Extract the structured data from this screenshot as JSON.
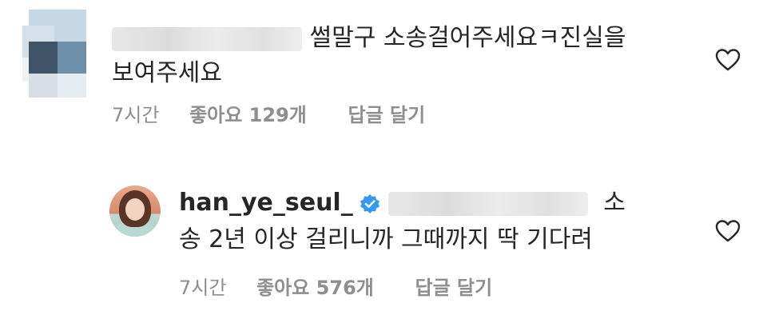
{
  "comments": [
    {
      "text_line1": "썰말구 소송걸어주세요ㅋ진실을",
      "text_line2": "보여주세요",
      "time": "7시간",
      "likes": "좋아요 129개",
      "reply": "답글 달기",
      "like_icon": "heart-outline-icon"
    },
    {
      "username": "han_ye_seul_",
      "verified_icon": "verified-badge-icon",
      "text_line1_tail": "소",
      "text_line2": "송 2년 이상 걸리니까 그때까지 딱 기다려",
      "time": "7시간",
      "likes": "좋아요 576개",
      "reply": "답글 달기",
      "like_icon": "heart-outline-icon"
    }
  ],
  "colors": {
    "text": "#262626",
    "secondary": "#8e8e8e",
    "verified_blue": "#3897f0"
  }
}
